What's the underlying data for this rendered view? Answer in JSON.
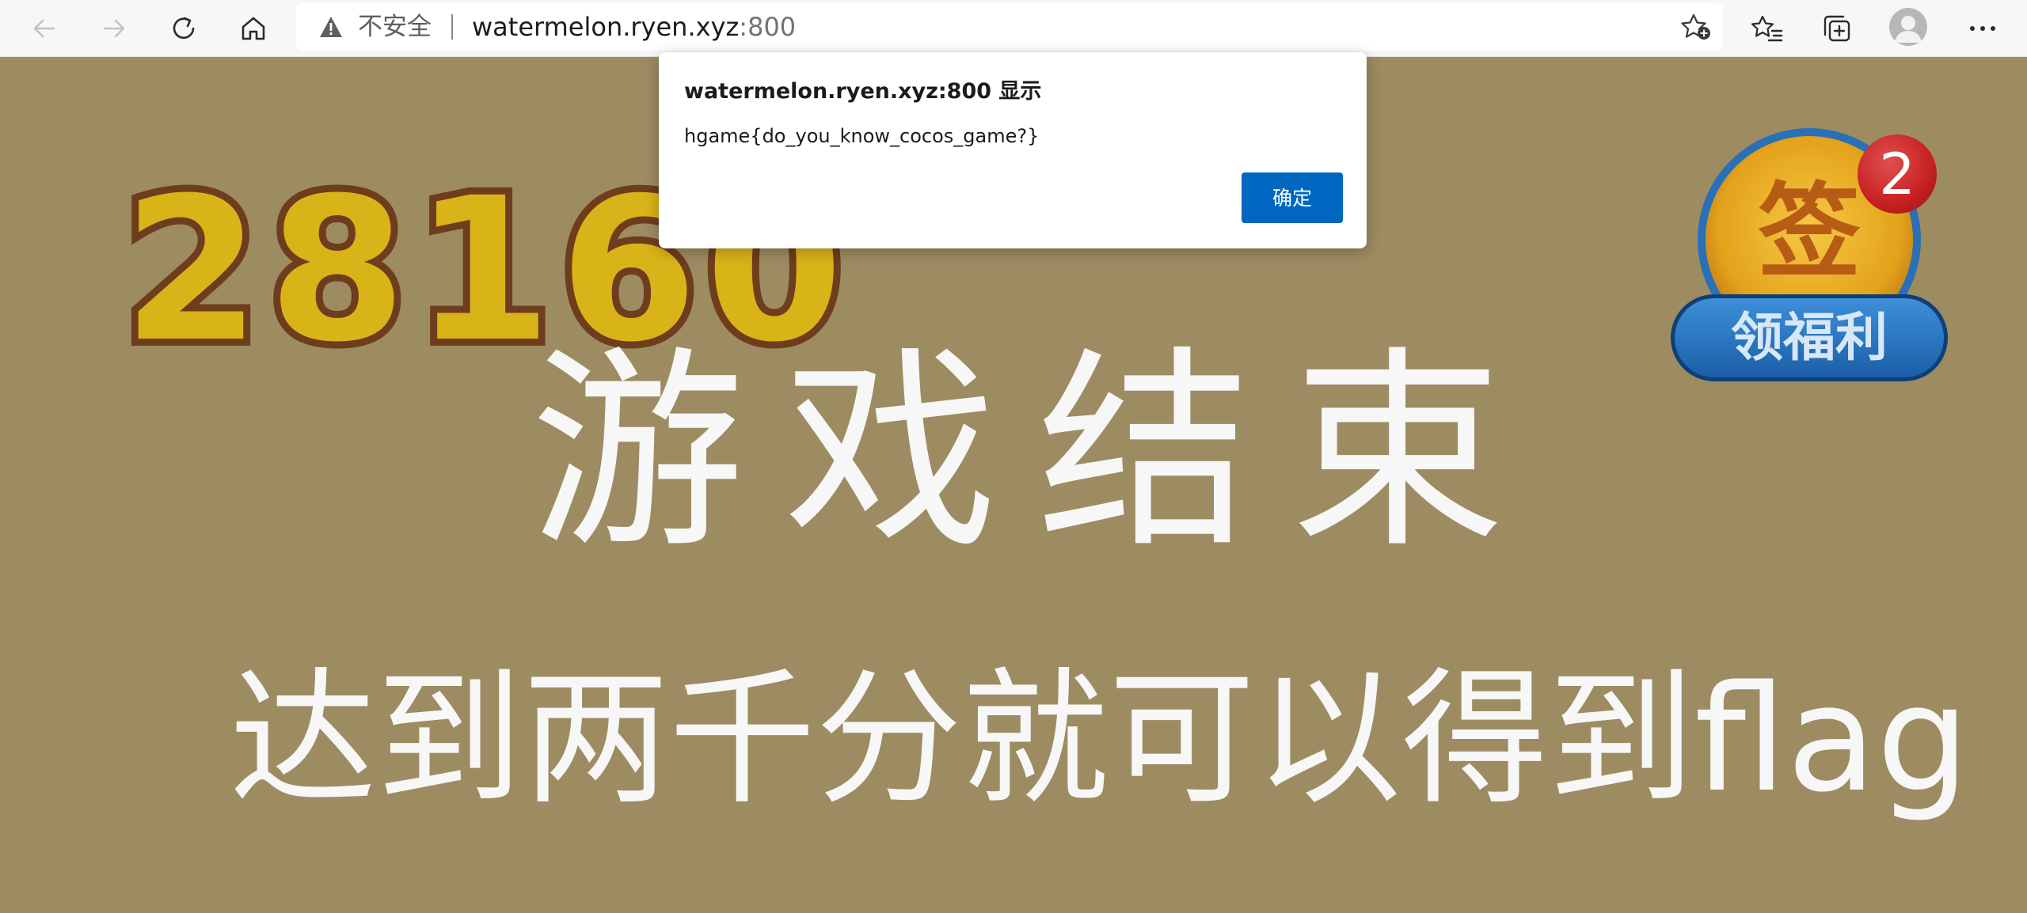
{
  "browser": {
    "security_label": "不安全",
    "url_host": "watermelon.ryen.xyz",
    "url_port": ":800",
    "icons": {
      "back": "arrow-left-icon",
      "forward": "arrow-right-icon",
      "refresh": "refresh-icon",
      "home": "home-icon",
      "warning": "warning-triangle-icon",
      "add_favorite": "star-plus-icon",
      "favorites": "favorites-list-icon",
      "collections": "collections-icon",
      "profile": "profile-avatar-icon",
      "more": "more-dots-icon"
    }
  },
  "game": {
    "score": "28160",
    "game_over": "游戏结束",
    "subtitle": "达到两千分就可以得到flag",
    "sign_badge": {
      "char": "签",
      "count": "2",
      "label": "领福利"
    }
  },
  "dialog": {
    "title": "watermelon.ryen.xyz:800 显示",
    "message": "hgame{do_you_know_cocos_game?}",
    "ok_label": "确定",
    "accent_color": "#0067c0"
  }
}
